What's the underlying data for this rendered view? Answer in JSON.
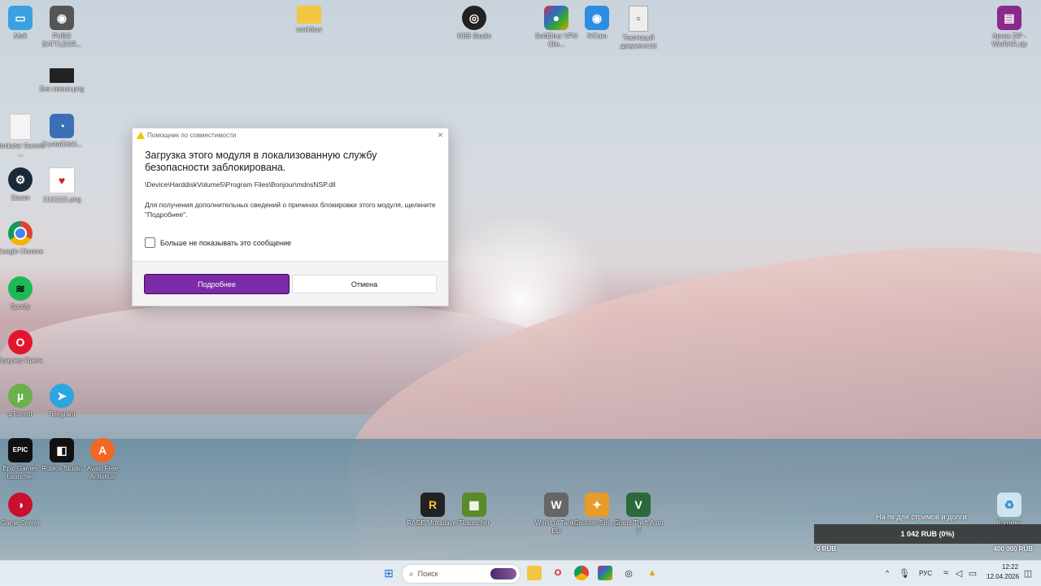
{
  "desktop_icons": [
    {
      "label": "Мой",
      "icon": "monitor-icon",
      "color": "#3aa0e0"
    },
    {
      "label": "PUBG BATTLEGR...",
      "icon": "pubg-icon",
      "color": "#555"
    },
    {
      "label": "Без имени.png",
      "icon": "image-icon",
      "color": "#222"
    },
    {
      "label": "Rockstar Games ...",
      "icon": "file-icon",
      "color": "#f4f4f4"
    },
    {
      "label": "CrystalDiskI...",
      "icon": "crystaldisk-icon",
      "color": "#3b6fb6"
    },
    {
      "label": "Steam",
      "icon": "steam-icon",
      "color": "#1b2838"
    },
    {
      "label": "11111111.png",
      "icon": "image-icon",
      "color": "#ffffff"
    },
    {
      "label": "Google Chrome",
      "icon": "chrome-icon",
      "color": "#db4437"
    },
    {
      "label": "Spotify",
      "icon": "spotify-icon",
      "color": "#1db954"
    },
    {
      "label": "Браузер Opera",
      "icon": "opera-icon",
      "color": "#e3142d"
    },
    {
      "label": "µTorrent",
      "icon": "utorrent-icon",
      "color": "#6ab04c"
    },
    {
      "label": "Telegram",
      "icon": "telegram-icon",
      "color": "#2ca5e0"
    },
    {
      "label": "Epic Games Launcher",
      "icon": "epic-icon",
      "color": "#111"
    },
    {
      "label": "Roblox Studio",
      "icon": "roblox-icon",
      "color": "#111"
    },
    {
      "label": "Avast Free Antivirus",
      "icon": "avast-icon",
      "color": "#f26722"
    },
    {
      "label": "Game Center",
      "icon": "gamecenter-icon",
      "color": "#c8102e"
    },
    {
      "label": "workflow",
      "icon": "folder-icon",
      "color": "#f4c542"
    },
    {
      "label": "OBS Studio",
      "icon": "obs-icon",
      "color": "#222"
    },
    {
      "label": "SoftEther VPN Clie...",
      "icon": "softether-icon",
      "color": "#d33"
    },
    {
      "label": "IVCam",
      "icon": "ivcam-icon",
      "color": "#2d8ee0"
    },
    {
      "label": "Текстовый документ.txt",
      "icon": "text-file-icon",
      "color": "#eee"
    },
    {
      "label": "Архив ZIP - WinRAR.zip",
      "icon": "winrar-icon",
      "color": "#8a2a8a"
    },
    {
      "label": "RAGE Multiplayer",
      "icon": "rage-icon",
      "color": "#222"
    },
    {
      "label": "TLauncher",
      "icon": "tlauncher-icon",
      "color": "#5a8a2a"
    },
    {
      "label": "World of Tanks EU",
      "icon": "wot-icon",
      "color": "#666"
    },
    {
      "label": "Counter-Stri... 2",
      "icon": "cs2-icon",
      "color": "#e89a2a"
    },
    {
      "label": "Grand Theft Auto V",
      "icon": "gta-icon",
      "color": "#2a6a3a"
    },
    {
      "label": "Корзина",
      "icon": "recycle-bin-icon",
      "color": "#cfe3f0"
    }
  ],
  "dialog": {
    "title": "Помощник по совместимости",
    "heading": "Загрузка этого модуля в локализованную службу безопасности заблокирована.",
    "path": "\\Device\\HarddiskVolume5\\Program Files\\Bonjour\\mdnsNSP.dll",
    "info": "Для получения дополнительных сведений о причинах блокировки этого модуля, щелкните \"Подробнее\".",
    "checkbox_label": "Больше не показывать это сообщение",
    "primary_button": "Подробнее",
    "secondary_button": "Отмена",
    "close_glyph": "×"
  },
  "widget": {
    "title": "На пк для стримов и долги",
    "value": "1 042 RUB (0%)",
    "min": "0 RUB",
    "max": "400 000 RUB"
  },
  "taskbar": {
    "search_placeholder": "Поиск",
    "language": "РУС",
    "time": "12:22",
    "date": "12.04.2026"
  }
}
